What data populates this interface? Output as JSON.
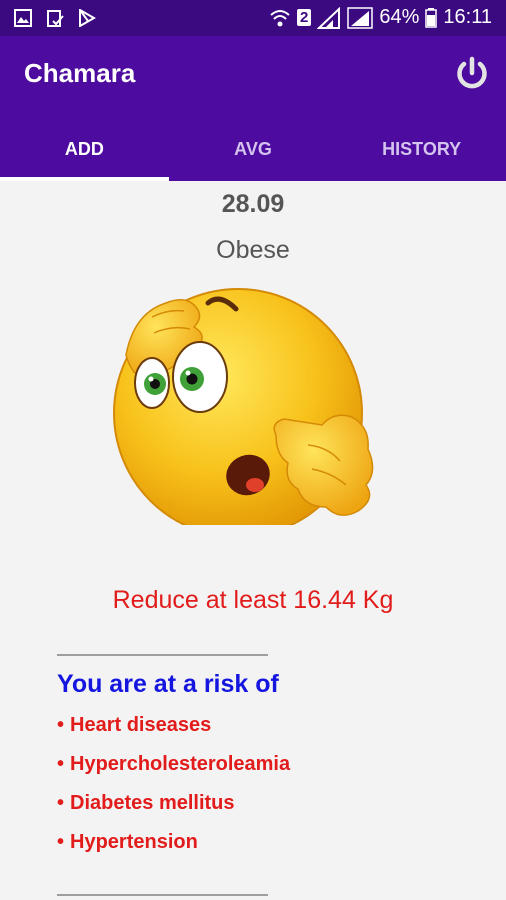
{
  "status_bar": {
    "battery": "64%",
    "time": "16:11",
    "sim_slot": "2",
    "left_icons": [
      "gallery-icon",
      "clipboard-check-icon",
      "play-store-icon"
    ]
  },
  "app_bar": {
    "title": "Chamara",
    "power_icon": "power-icon"
  },
  "tabs": [
    {
      "label": "ADD",
      "active": true
    },
    {
      "label": "AVG",
      "active": false
    },
    {
      "label": "HISTORY",
      "active": false
    }
  ],
  "result": {
    "bmi_value": "28.09",
    "category": "Obese",
    "emoji": "surprised-emoji-icon",
    "advice": "Reduce at least 16.44 Kg"
  },
  "risk": {
    "title": "You are at a risk of",
    "items": [
      "Heart diseases",
      "Hypercholesteroleamia",
      "Diabetes mellitus",
      "Hypertension"
    ]
  },
  "colors": {
    "app_bar": "#4e0b9f",
    "status_bar": "#3b0a80",
    "warning_red": "#e21b1b",
    "risk_blue": "#1515e0"
  }
}
